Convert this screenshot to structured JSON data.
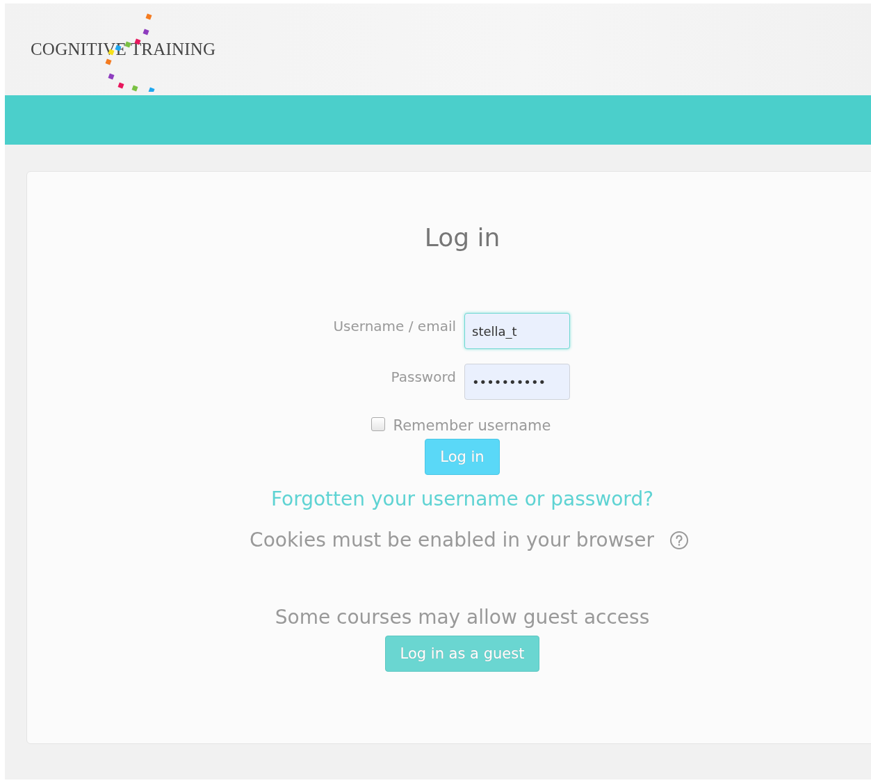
{
  "header": {
    "logo_text": "COGNITIVE TRAINING"
  },
  "login": {
    "title": "Log in",
    "fields": [
      {
        "label": "Username / email",
        "value": "stella_t",
        "focused": true
      },
      {
        "label": "Password",
        "value": "••••••••••",
        "focused": false
      }
    ],
    "remember": {
      "label": "Remember username",
      "checked": false
    },
    "submit": "Log in",
    "forgot_link": "Forgotten your username or password?",
    "cookies_note": "Cookies must be enabled in your browser",
    "guest_note": "Some courses may allow guest access",
    "guest_button": "Log in as a guest"
  }
}
